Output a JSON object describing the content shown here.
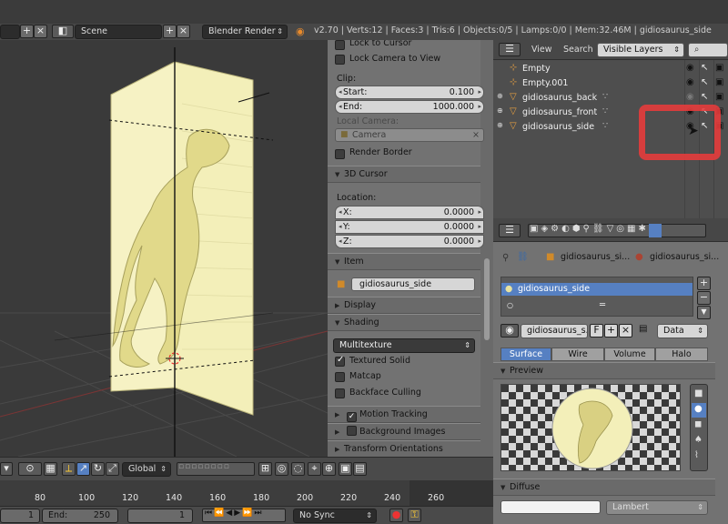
{
  "header": {
    "scene_label": "Scene",
    "render_engine": "Blender Render",
    "stats": "v2.70 | Verts:12 | Faces:3 | Tris:6 | Objects:0/5 | Lamps:0/0 | Mem:32.46M | gidiosaurus_side"
  },
  "npanel": {
    "lock_to_cursor": "Lock to Cursor",
    "lock_camera_to_view": "Lock Camera to View",
    "clip_label": "Clip:",
    "start_label": "Start:",
    "start_value": "0.100",
    "end_label": "End:",
    "end_value": "1000.000",
    "local_camera_label": "Local Camera:",
    "camera_field": "Camera",
    "render_border": "Render Border",
    "cursor_section": "3D Cursor",
    "location_label": "Location:",
    "x_label": "X:",
    "x_value": "0.0000",
    "y_label": "Y:",
    "y_value": "0.0000",
    "z_label": "Z:",
    "z_value": "0.0000",
    "item_section": "Item",
    "item_name": "gidiosaurus_side",
    "display_section": "Display",
    "shading_section": "Shading",
    "shading_mode": "Multitexture",
    "textured_solid": "Textured Solid",
    "matcap": "Matcap",
    "backface_culling": "Backface Culling",
    "motion_tracking": "Motion Tracking",
    "background_images": "Background Images",
    "transform_orientations": "Transform Orientations"
  },
  "outliner": {
    "view_menu": "View",
    "search_menu": "Search",
    "filter": "Visible Layers",
    "items": [
      {
        "label": "Empty"
      },
      {
        "label": "Empty.001"
      },
      {
        "label": "gidiosaurus_back"
      },
      {
        "label": "gidiosaurus_front"
      },
      {
        "label": "gidiosaurus_side"
      }
    ]
  },
  "props": {
    "breadcrumb_object": "gidiosaurus_si...",
    "breadcrumb_material": "gidiosaurus_si...",
    "slot_name": "gidiosaurus_side",
    "material_name": "gidiosaurus_s...",
    "fake_user": "F",
    "link_type": "Data",
    "tabs": [
      "Surface",
      "Wire",
      "Volume",
      "Halo"
    ],
    "preview_section": "Preview",
    "diffuse_section": "Diffuse",
    "diffuse_shader": "Lambert"
  },
  "viewheader": {
    "orientation": "Global"
  },
  "timeline": {
    "ticks": [
      "80",
      "100",
      "120",
      "140",
      "160",
      "180",
      "200",
      "220",
      "240",
      "260"
    ],
    "start_value": "1",
    "end_label": "End:",
    "end_value": "250",
    "current_frame": "1",
    "sync_mode": "No Sync"
  },
  "colors": {
    "selection": "#5680c2",
    "highlight": "#e93b3b",
    "image_plane": "#f3efb9"
  }
}
